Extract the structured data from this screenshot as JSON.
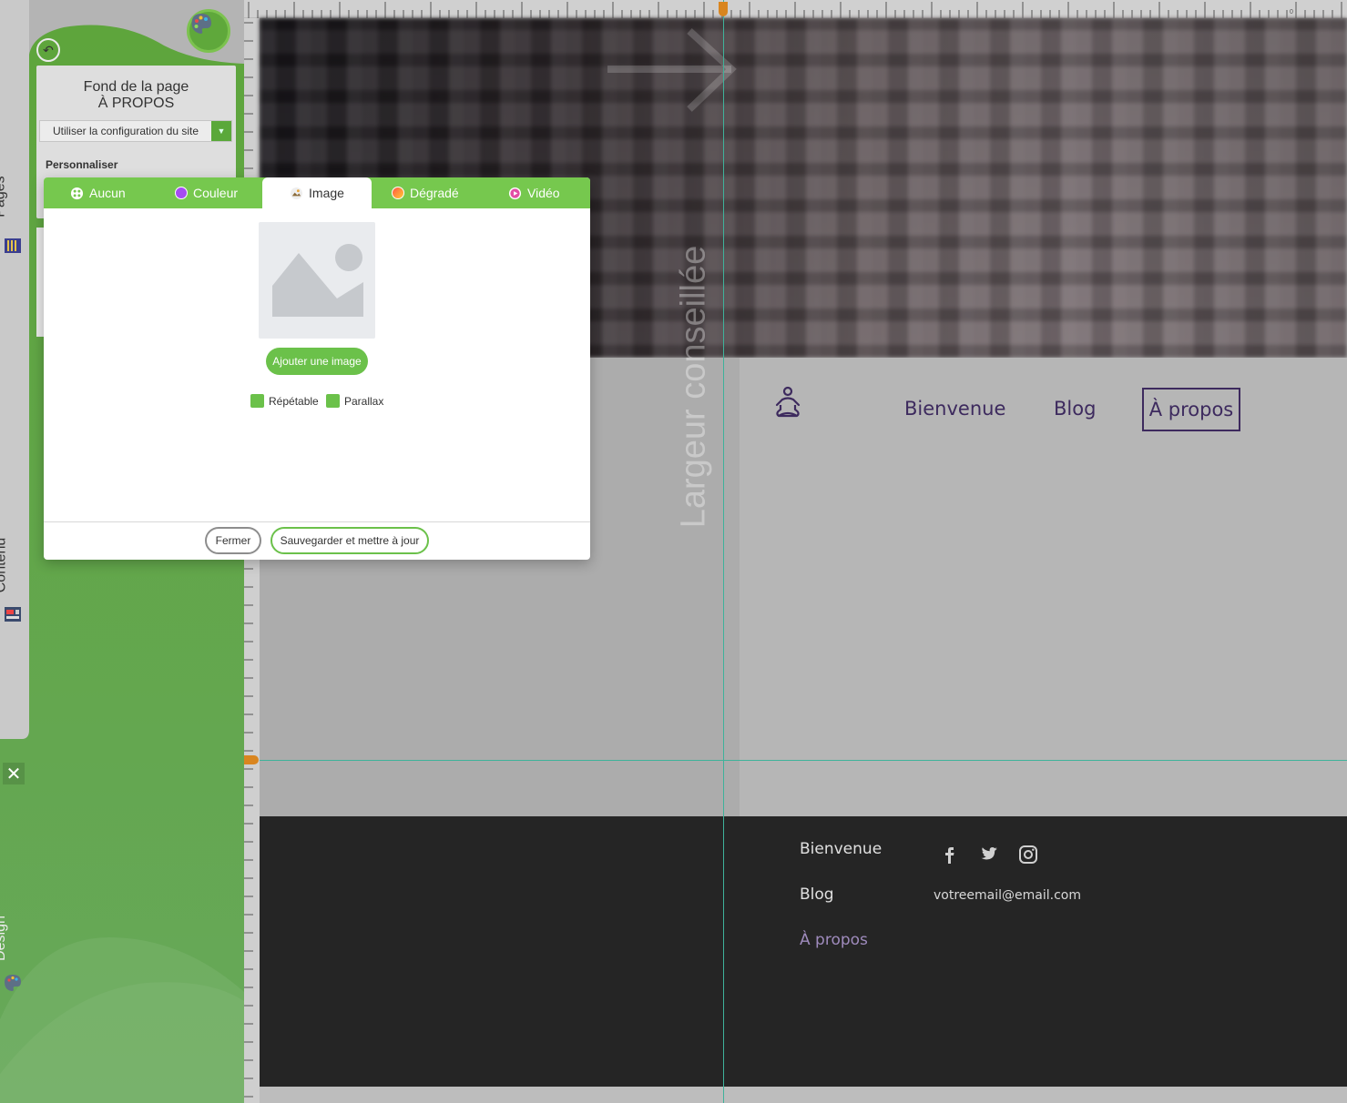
{
  "sidebar": {
    "tabs": [
      {
        "label": "Pages",
        "icon": "pages-icon"
      },
      {
        "label": "Contenu",
        "icon": "content-icon"
      },
      {
        "label": "Design",
        "icon": "palette-icon"
      }
    ],
    "panel_title_line1": "Fond de la page",
    "panel_title_line2": "À PROPOS",
    "config_select": "Utiliser la configuration du site",
    "personalize_label": "Personnaliser"
  },
  "modal": {
    "tabs": [
      {
        "label": "Aucun",
        "icon": "none-icon"
      },
      {
        "label": "Couleur",
        "icon": "color-icon"
      },
      {
        "label": "Image",
        "icon": "image-icon",
        "active": true
      },
      {
        "label": "Dégradé",
        "icon": "gradient-icon"
      },
      {
        "label": "Vidéo",
        "icon": "video-icon"
      }
    ],
    "add_image_label": "Ajouter une image",
    "checkboxes": [
      {
        "label": "Répétable",
        "checked": true
      },
      {
        "label": "Parallax",
        "checked": true
      }
    ],
    "close_label": "Fermer",
    "save_label": "Sauvegarder et mettre à jour"
  },
  "canvas": {
    "watermark": "Largeur conseillée",
    "ruler_zero": "0",
    "nav": {
      "items": [
        "Bienvenue",
        "Blog",
        "À propos"
      ],
      "active": "À propos"
    },
    "footer": {
      "links": [
        "Bienvenue",
        "Blog",
        "À propos"
      ],
      "email": "votreemail@email.com",
      "social": [
        "facebook-icon",
        "twitter-icon",
        "instagram-icon"
      ]
    }
  },
  "colors": {
    "sidebar_green": "#5ea53c",
    "tab_green": "#76c84e",
    "nav_purple": "#3d2a5e",
    "guide": "#3fb29a",
    "ruler_marker": "#d9851f",
    "footer_bg": "#252525"
  }
}
